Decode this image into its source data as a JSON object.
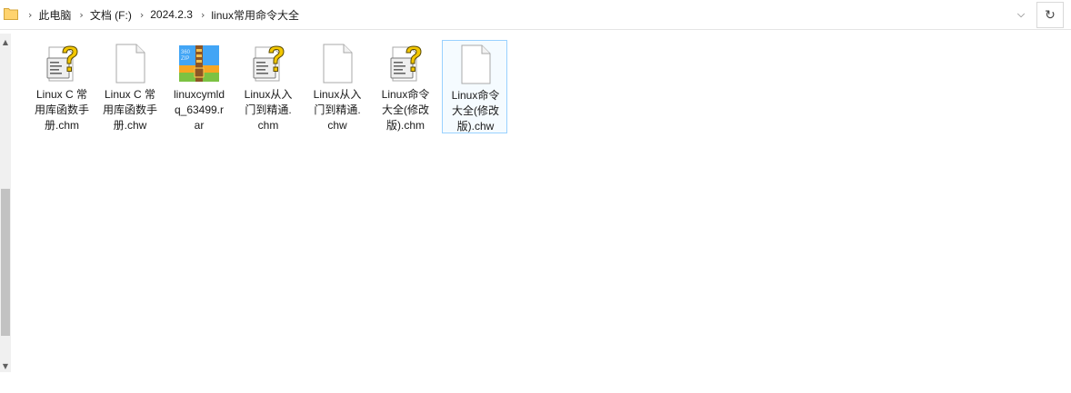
{
  "breadcrumb": [
    "此电脑",
    "文档 (F:)",
    "2024.2.3",
    "linux常用命令大全"
  ],
  "files": [
    {
      "name": "Linux C 常用库函数手册.chm",
      "lines": [
        "Linux C 常",
        "用库函数手",
        "册.chm"
      ],
      "icon": "chm-help-icon",
      "selected": false
    },
    {
      "name": "Linux C 常用库函数手册.chw",
      "lines": [
        "Linux C 常",
        "用库函数手",
        "册.chw"
      ],
      "icon": "blank-file-icon",
      "selected": false
    },
    {
      "name": "linuxcymldq_63499.rar",
      "lines": [
        "linuxcymld",
        "q_63499.r",
        "ar"
      ],
      "icon": "zip-archive-icon",
      "selected": false
    },
    {
      "name": "Linux从入门到精通.chm",
      "lines": [
        "Linux从入",
        "门到精通.",
        "chm"
      ],
      "icon": "chm-help-icon",
      "selected": false
    },
    {
      "name": "Linux从入门到精通.chw",
      "lines": [
        "Linux从入",
        "门到精通.",
        "chw"
      ],
      "icon": "blank-file-icon",
      "selected": false
    },
    {
      "name": "Linux命令大全(修改版).chm",
      "lines": [
        "Linux命令",
        "大全(修改",
        "版).chm"
      ],
      "icon": "chm-help-icon",
      "selected": false
    },
    {
      "name": "Linux命令大全(修改版).chw",
      "lines": [
        "Linux命令",
        "大全(修改",
        "版).chw"
      ],
      "icon": "blank-file-icon",
      "selected": true
    }
  ],
  "zip_badge": {
    "top": "360",
    "bottom": "ZIP"
  },
  "colors": {
    "selection_border": "#99d1ff",
    "folder": "#ffd36e",
    "help_yellow": "#f3c700"
  }
}
